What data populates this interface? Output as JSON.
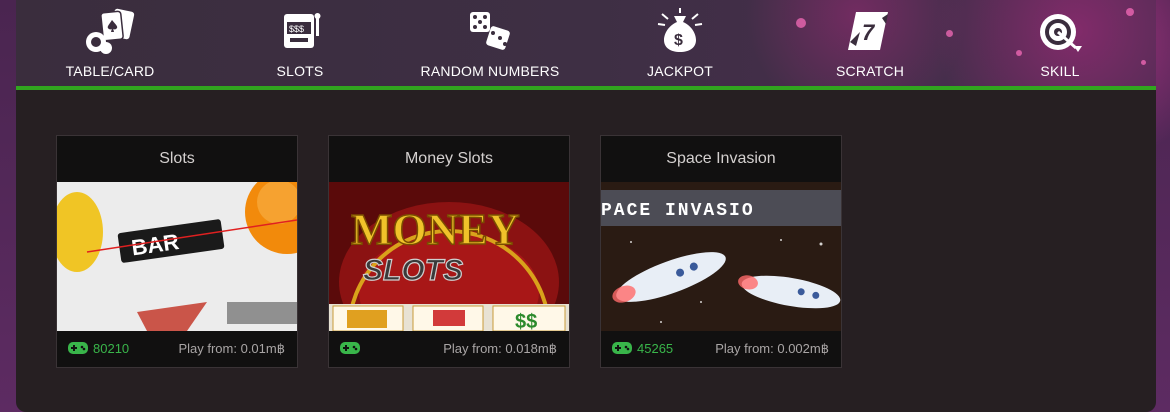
{
  "nav": {
    "items": [
      {
        "label": "TABLE/CARD",
        "icon": "cards-chips-icon"
      },
      {
        "label": "SLOTS",
        "icon": "slot-machine-icon"
      },
      {
        "label": "RANDOM NUMBERS",
        "icon": "dice-icon"
      },
      {
        "label": "JACKPOT",
        "icon": "money-bag-icon"
      },
      {
        "label": "SCRATCH",
        "icon": "scratch-card-icon"
      },
      {
        "label": "SKILL",
        "icon": "target-icon"
      }
    ]
  },
  "games": [
    {
      "title": "Slots",
      "plays": "80210",
      "price": "Play from: 0.01m฿",
      "thumb_text": "BAR"
    },
    {
      "title": "Money Slots",
      "plays": "",
      "price": "Play from: 0.018m฿",
      "thumb_text_1": "MONEY",
      "thumb_text_2": "SLOTS"
    },
    {
      "title": "Space Invasion",
      "plays": "45265",
      "price": "Play from: 0.002m฿",
      "thumb_text": "PACE INVASIO"
    }
  ],
  "colors": {
    "accent": "#31a51f",
    "plays": "#39b54a",
    "panel": "#261f22"
  }
}
